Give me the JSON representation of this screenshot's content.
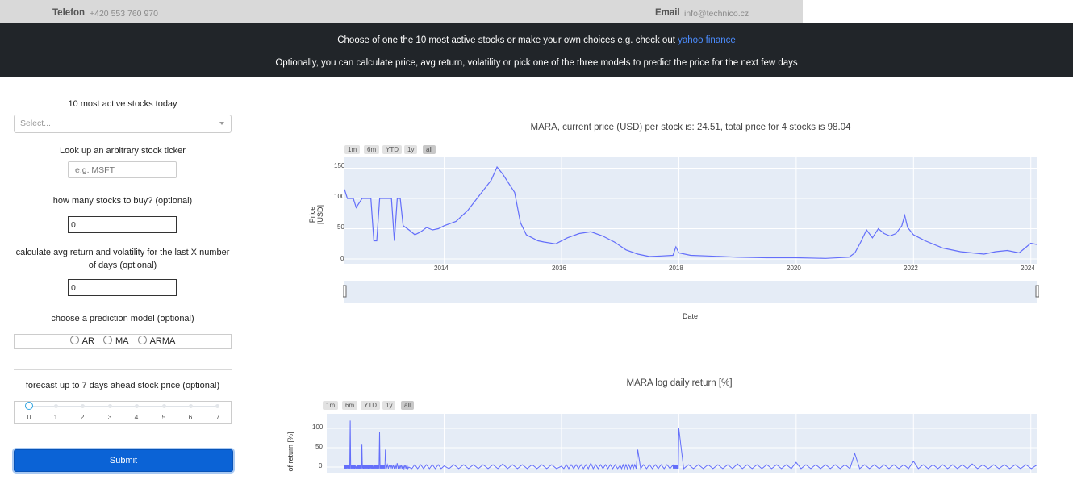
{
  "topbar": {
    "phone_label": "Telefon",
    "phone_value": "+420 553 760 970",
    "email_label": "Email",
    "email_value": "info@technico.cz"
  },
  "banner": {
    "line1_prefix": "Choose of one the 10 most active stocks or make your own choices e.g. check out",
    "line1_link": "yahoo finance",
    "line2": "Optionally, you can calculate price, avg return, volatility or pick one of the three models to predict the price for the next few days"
  },
  "form": {
    "active_title": "10 most active stocks today",
    "active_placeholder": "Select...",
    "lookup_title": "Look up an arbitrary stock ticker",
    "lookup_placeholder": "e.g. MSFT",
    "qty_title": "how many stocks to buy? (optional)",
    "qty_value": "0",
    "days_title": "calculate avg return and volatility for the last X number of days (optional)",
    "days_value": "0",
    "model_title": "choose a prediction model (optional)",
    "models": [
      "AR",
      "MA",
      "ARMA"
    ],
    "forecast_title": "forecast up to 7 days ahead stock price (optional)",
    "forecast_ticks": [
      "0",
      "1",
      "2",
      "3",
      "4",
      "5",
      "6",
      "7"
    ],
    "forecast_value": 0,
    "submit_label": "Submit"
  },
  "range_buttons": [
    "1m",
    "6m",
    "YTD",
    "1y",
    "all"
  ],
  "colors": {
    "banner_bg": "#212529",
    "link": "#4c8dff",
    "submit": "#0b63d6",
    "plot_bg": "#e5ecf6",
    "line": "#636efa"
  },
  "chart_data": [
    {
      "type": "line",
      "title": "MARA, current price (USD) per stock is: 24.51, total price for 4 stocks is 98.04",
      "xlabel": "Date",
      "ylabel": "Price [USD]",
      "x_ticks": [
        "2014",
        "2016",
        "2018",
        "2020",
        "2022",
        "2024"
      ],
      "y_ticks": [
        0,
        50,
        100,
        150
      ],
      "ylim": [
        0,
        160
      ],
      "xlim": [
        2012.3,
        2024.1
      ],
      "grid": true,
      "range_slider": true,
      "series": [
        {
          "x": [
            2012.3,
            2012.35,
            2012.45,
            2012.5,
            2012.6,
            2012.75,
            2012.8,
            2012.85,
            2012.9,
            2012.95,
            2013.0,
            2013.05,
            2013.1,
            2013.15,
            2013.2,
            2013.25,
            2013.3,
            2013.4,
            2013.5,
            2013.6,
            2013.7,
            2013.8,
            2013.9,
            2014.0,
            2014.2,
            2014.4,
            2014.6,
            2014.8,
            2014.9,
            2015.0,
            2015.1,
            2015.2,
            2015.3,
            2015.4,
            2015.5,
            2015.6,
            2015.7,
            2015.9,
            2016.1,
            2016.3,
            2016.5,
            2016.7,
            2016.9,
            2017.1,
            2017.3,
            2017.5,
            2017.7,
            2017.9,
            2017.95,
            2018.0,
            2018.2,
            2018.5,
            2019.0,
            2019.5,
            2020.0,
            2020.5,
            2020.9,
            2021.0,
            2021.1,
            2021.2,
            2021.3,
            2021.4,
            2021.5,
            2021.6,
            2021.7,
            2021.8,
            2021.85,
            2021.9,
            2022.0,
            2022.2,
            2022.5,
            2022.8,
            2023.0,
            2023.2,
            2023.4,
            2023.6,
            2023.8,
            2023.9,
            2024.0,
            2024.1
          ],
          "y": [
            115,
            100,
            100,
            85,
            100,
            100,
            30,
            30,
            100,
            100,
            100,
            100,
            100,
            30,
            100,
            100,
            55,
            48,
            40,
            45,
            52,
            48,
            50,
            55,
            62,
            80,
            105,
            130,
            152,
            140,
            125,
            110,
            60,
            40,
            35,
            30,
            28,
            25,
            35,
            42,
            45,
            38,
            28,
            15,
            8,
            4,
            5,
            6,
            20,
            10,
            6,
            5,
            3,
            2,
            2,
            1,
            3,
            10,
            28,
            48,
            35,
            50,
            42,
            38,
            42,
            55,
            72,
            52,
            40,
            30,
            18,
            12,
            10,
            8,
            12,
            14,
            10,
            18,
            26,
            24
          ]
        }
      ]
    },
    {
      "type": "line",
      "title": "MARA log daily return [%]",
      "xlabel": "",
      "ylabel": "of return [%]",
      "y_ticks": [
        0,
        50,
        100
      ],
      "ylim": [
        -10,
        140
      ],
      "grid": true,
      "series": [
        {
          "x": [
            2012.3,
            2012.4,
            2012.5,
            2012.6,
            2012.7,
            2012.8,
            2012.9,
            2013.0,
            2013.2,
            2013.4,
            2014.0,
            2015.0,
            2016.0,
            2016.5,
            2017.0,
            2017.3,
            2017.9,
            2018.0,
            2019.0,
            2020.0,
            2021.0,
            2022.0,
            2023.0,
            2024.1
          ],
          "y": [
            5,
            120,
            0,
            60,
            5,
            0,
            90,
            45,
            10,
            0,
            3,
            8,
            2,
            10,
            4,
            45,
            5,
            100,
            8,
            12,
            35,
            15,
            8,
            5
          ]
        }
      ]
    }
  ]
}
